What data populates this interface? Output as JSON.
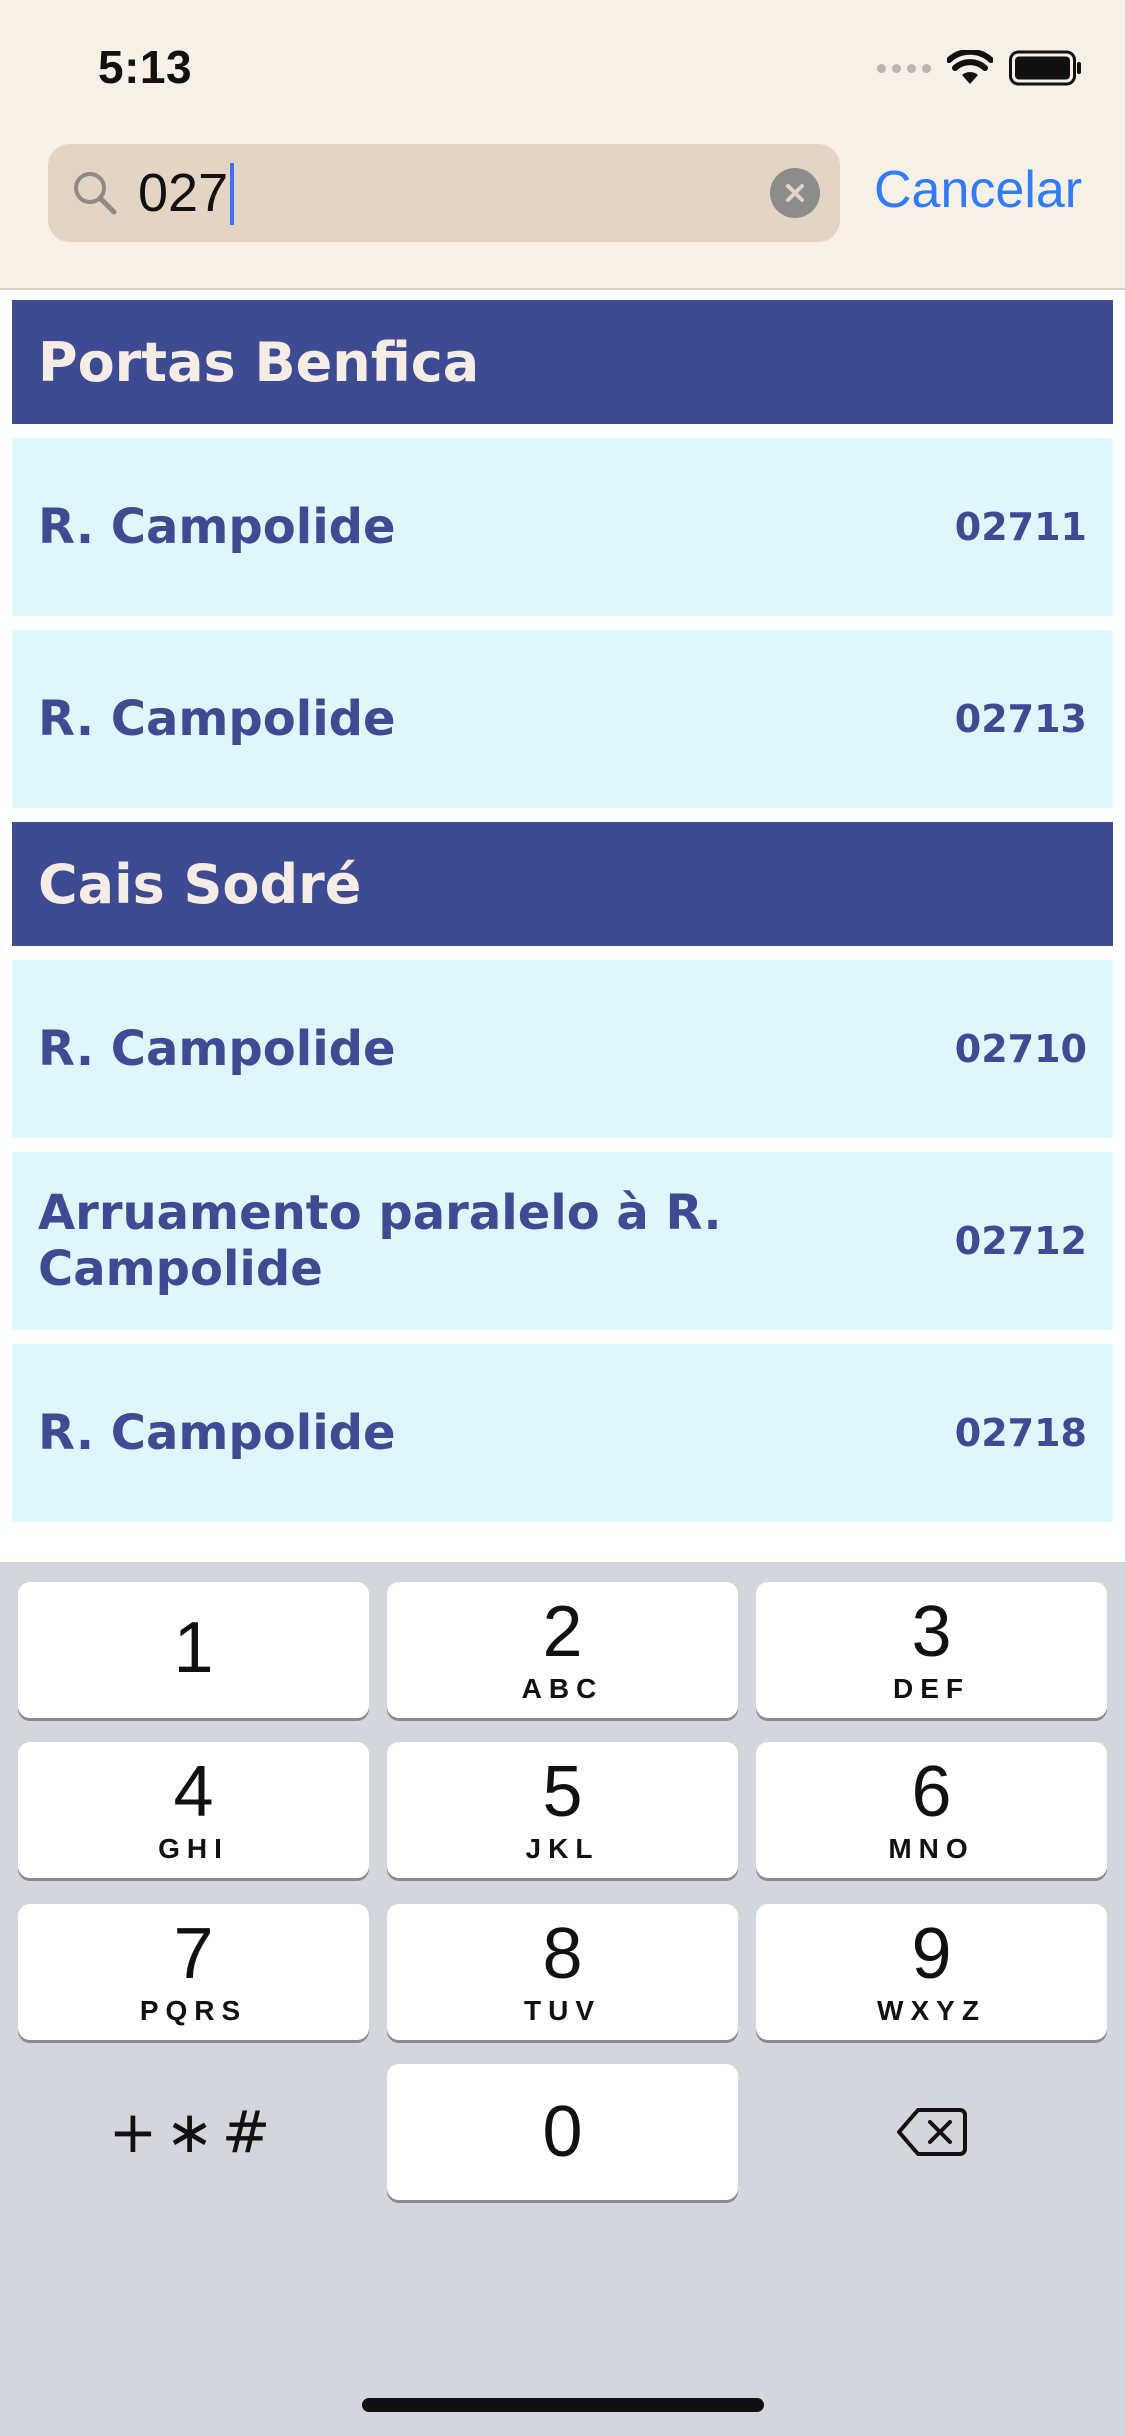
{
  "status_bar": {
    "time": "5:13"
  },
  "search": {
    "value": "027",
    "cancel_label": "Cancelar"
  },
  "sections": [
    {
      "title": "Portas Benfica",
      "rows": [
        {
          "name": "R. Campolide",
          "code": "02711"
        },
        {
          "name": "R. Campolide",
          "code": "02713"
        }
      ]
    },
    {
      "title": "Cais Sodré",
      "rows": [
        {
          "name": "R. Campolide",
          "code": "02710"
        },
        {
          "name": "Arruamento paralelo à R. Campolide",
          "code": "02712"
        },
        {
          "name": "R. Campolide",
          "code": "02718"
        }
      ]
    }
  ],
  "keypad": [
    {
      "digit": "1",
      "letters": ""
    },
    {
      "digit": "2",
      "letters": "ABC"
    },
    {
      "digit": "3",
      "letters": "DEF"
    },
    {
      "digit": "4",
      "letters": "GHI"
    },
    {
      "digit": "5",
      "letters": "JKL"
    },
    {
      "digit": "6",
      "letters": "MNO"
    },
    {
      "digit": "7",
      "letters": "PQRS"
    },
    {
      "digit": "8",
      "letters": "TUV"
    },
    {
      "digit": "9",
      "letters": "WXYZ"
    },
    {
      "digit": "0",
      "letters": ""
    }
  ],
  "keypad_symbols": "+∗#",
  "icons": {
    "search": "magnifier-icon",
    "clear": "clear-circle-icon",
    "delete": "backspace-icon",
    "signal": "cellular-signal-icon",
    "wifi": "wifi-icon",
    "battery": "battery-icon"
  },
  "colors": {
    "header_bg": "#f8efe6",
    "section_bg": "#3d4b93",
    "row_bg": "#def7fd",
    "accent": "#2f7cf6"
  }
}
